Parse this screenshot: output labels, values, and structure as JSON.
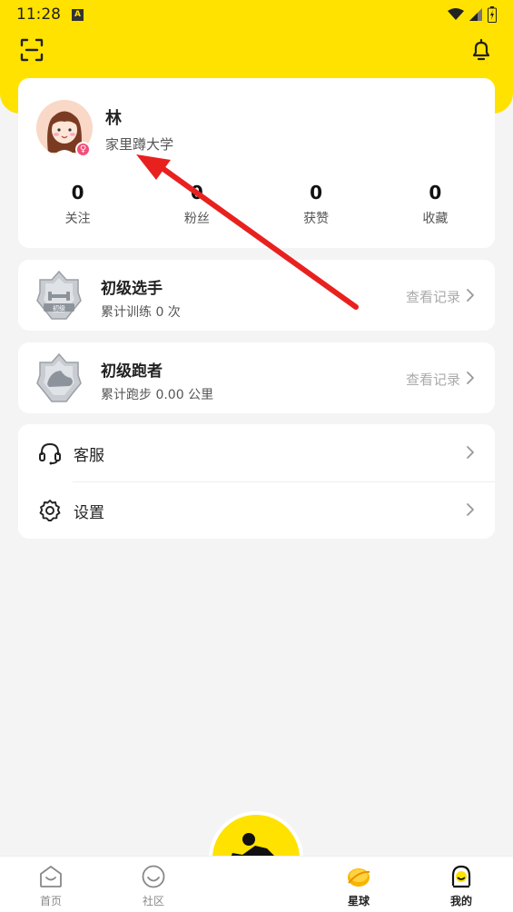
{
  "status_bar": {
    "time": "11:28",
    "notif_letter": "A"
  },
  "profile": {
    "name": "林",
    "school": "家里蹲大学",
    "gender_symbol": "♀",
    "stats": [
      {
        "value": "0",
        "label": "关注"
      },
      {
        "value": "0",
        "label": "粉丝"
      },
      {
        "value": "0",
        "label": "获赞"
      },
      {
        "value": "0",
        "label": "收藏"
      }
    ]
  },
  "levels": [
    {
      "title": "初级选手",
      "subtitle": "累计训练 0 次",
      "link": "查看记录",
      "medal_text": "初级"
    },
    {
      "title": "初级跑者",
      "subtitle": "累计跑步 0.00 公里",
      "link": "查看记录"
    }
  ],
  "menu": [
    {
      "label": "客服",
      "icon": "headset-icon"
    },
    {
      "label": "设置",
      "icon": "gear-icon"
    }
  ],
  "tabbar": {
    "tabs": [
      {
        "label": "首页",
        "icon": "home-icon",
        "active": false
      },
      {
        "label": "社区",
        "icon": "smile-icon",
        "active": false
      },
      {
        "label": "星球",
        "icon": "planet-icon",
        "active": true
      },
      {
        "label": "我的",
        "icon": "profile-icon",
        "active": true
      }
    ]
  },
  "colors": {
    "brand_yellow": "#ffe200",
    "arrow_red": "#e8211f"
  }
}
